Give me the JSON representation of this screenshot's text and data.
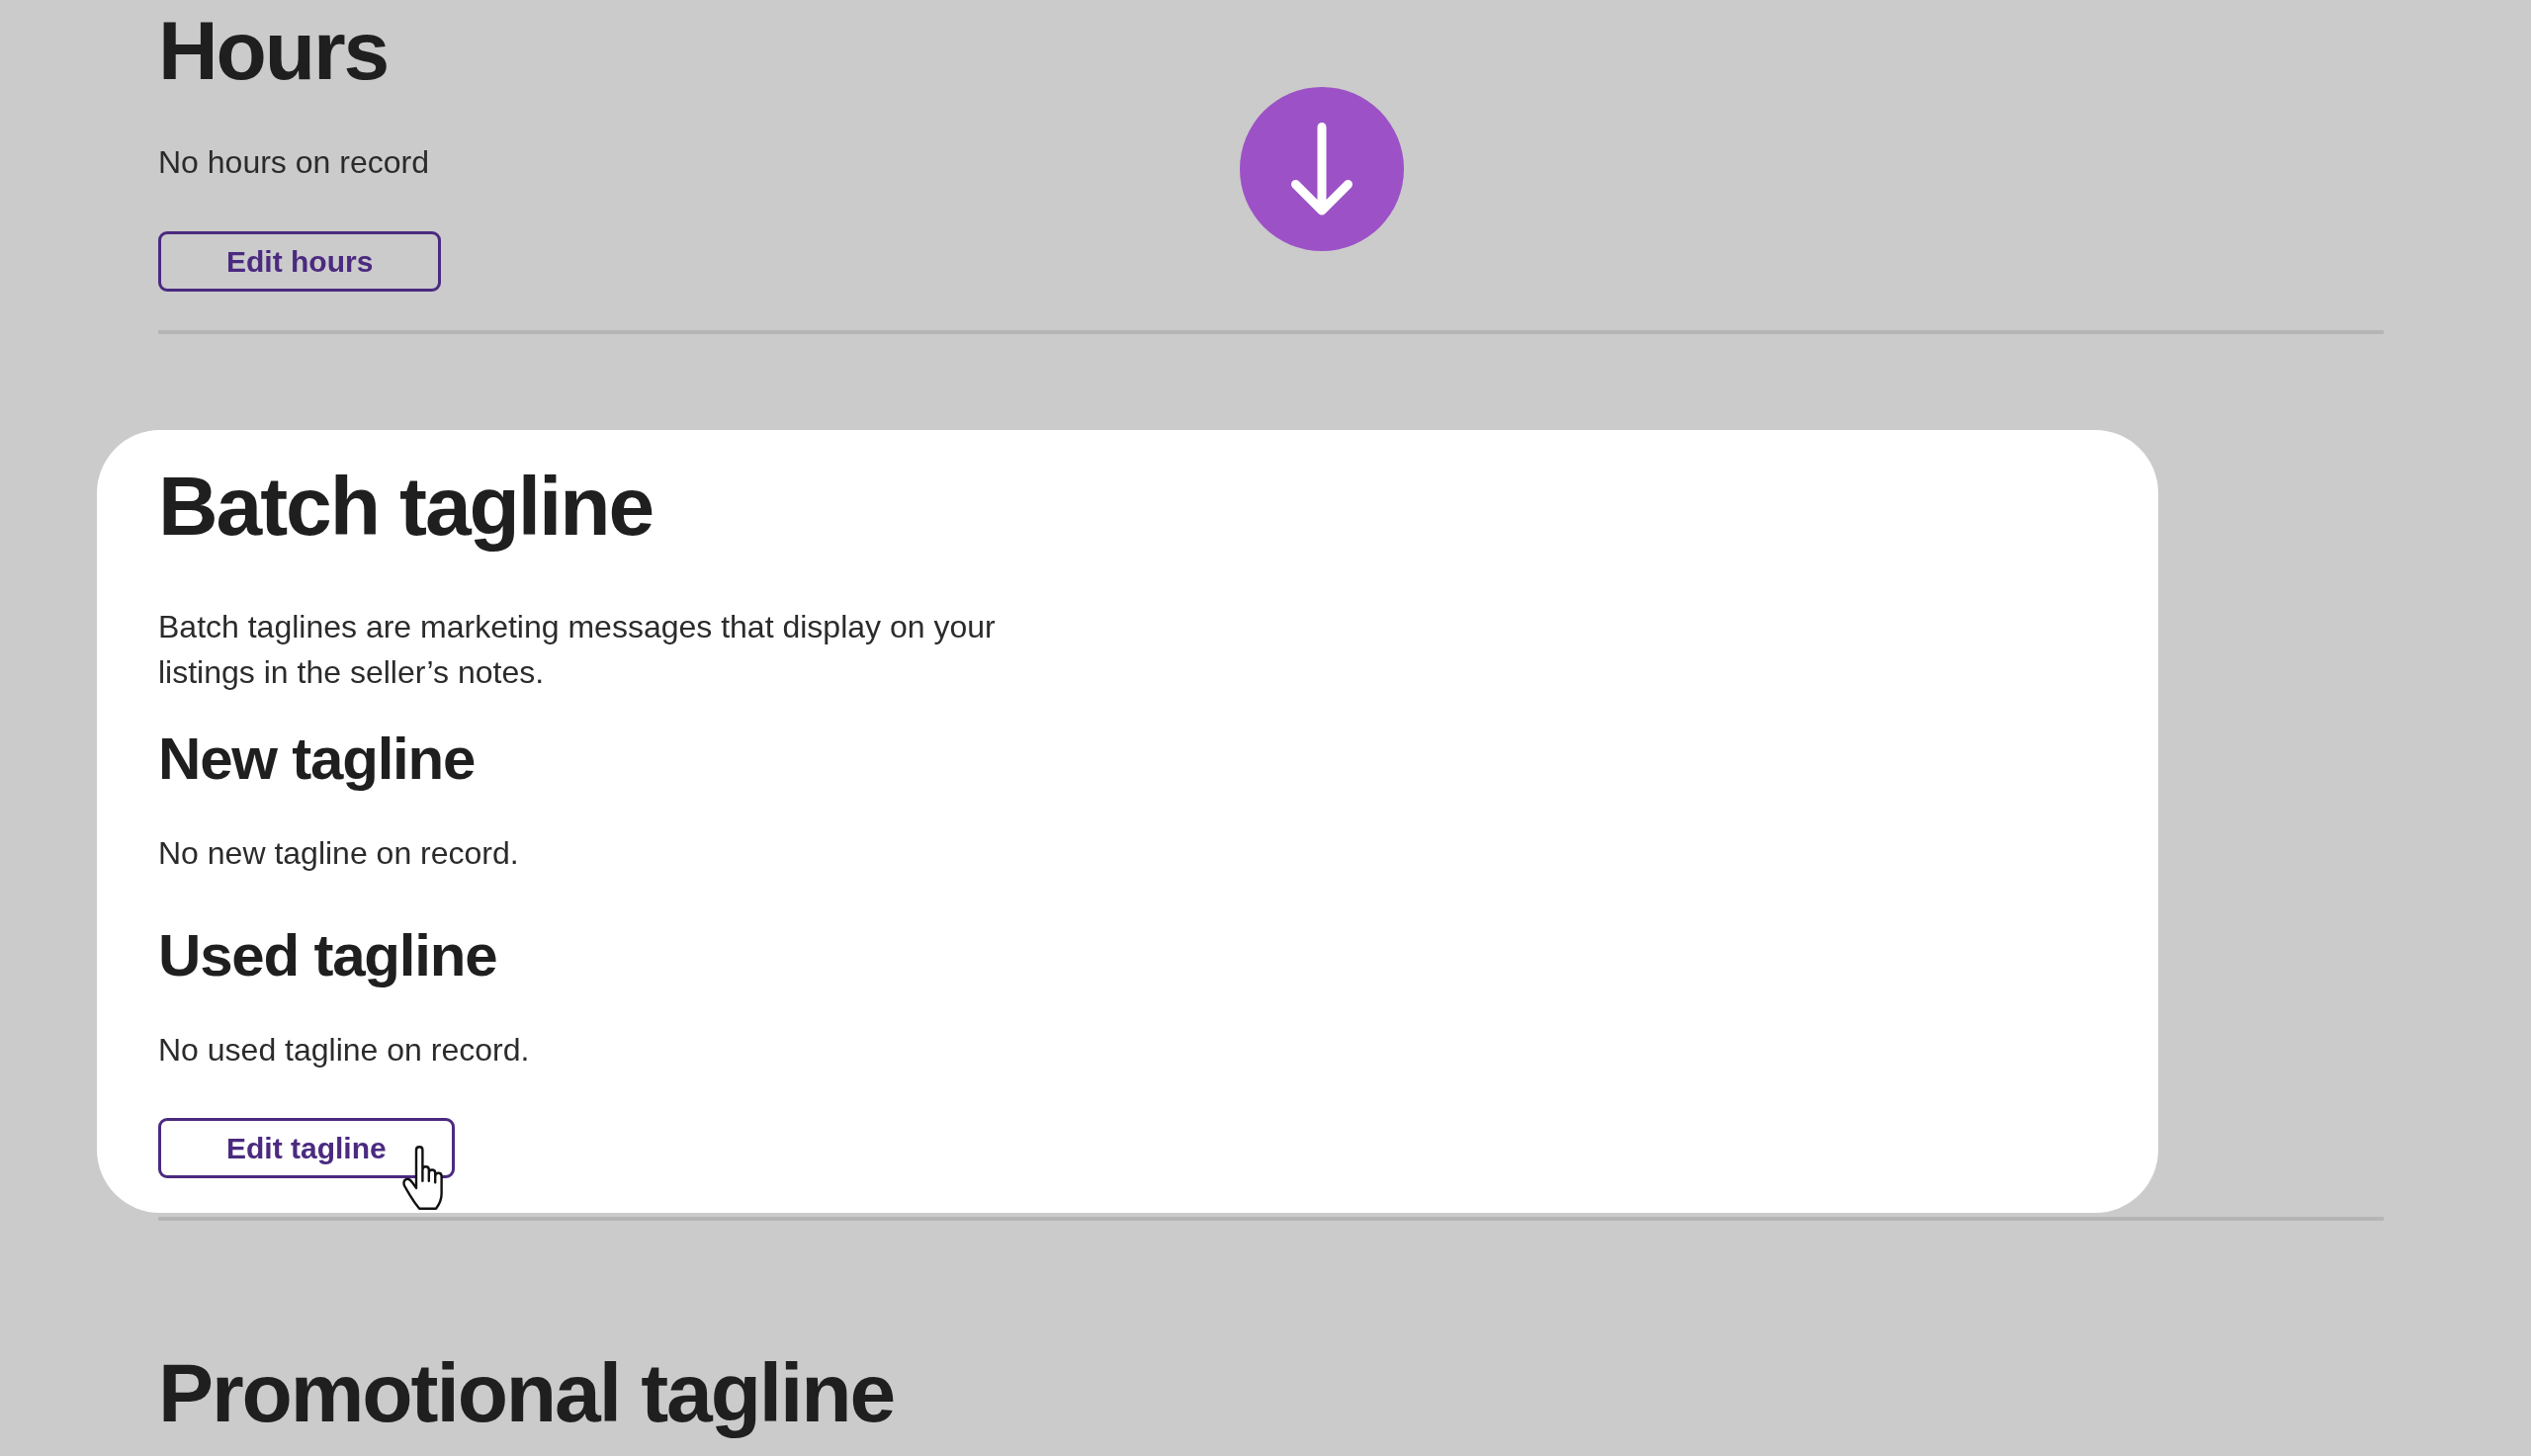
{
  "sections": [
    {
      "title": "Hours",
      "highlighted": false,
      "note": "No hours on record",
      "button": {
        "label": "Edit hours",
        "hovered": false
      }
    },
    {
      "title": "Batch tagline",
      "highlighted": true,
      "description": "Batch taglines are marketing messages that display on your listings in the seller’s notes.",
      "groups": [
        {
          "title": "New tagline",
          "note": "No new tagline on record."
        },
        {
          "title": "Used tagline",
          "note": "No used tagline on record."
        }
      ],
      "button": {
        "label": "Edit tagline",
        "hovered": true
      }
    },
    {
      "title": "Promotional tagline",
      "highlighted": false
    }
  ]
}
